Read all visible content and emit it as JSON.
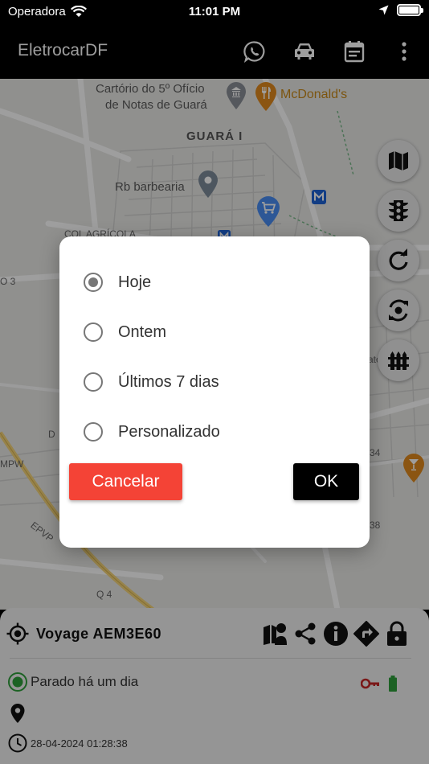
{
  "status_bar": {
    "carrier": "Operadora",
    "time": "11:01 PM"
  },
  "app_bar": {
    "title": "EletrocarDF",
    "actions": [
      "whatsapp-icon",
      "car-icon",
      "event-note-icon",
      "more-vert-icon"
    ]
  },
  "map": {
    "labels": {
      "cartorio_line1": "Cartório do 5º Ofício",
      "cartorio_line2": "de Notas de Guará",
      "mcdonalds": "McDonald's",
      "guara": "GUARÁ I",
      "barbearia": "Rb barbearia",
      "col_agricola": "COL AGRÍCOLA",
      "q3": "O 3",
      "mpw": "MPW",
      "epvp": "EPVP",
      "q4": "Q 4",
      "d": "D",
      "n34": "34",
      "n38": "38",
      "ato": "ato"
    },
    "side_buttons": [
      "map-icon",
      "traffic-light-icon",
      "refresh-icon",
      "sync-icon",
      "fence-icon"
    ]
  },
  "dialog": {
    "options": [
      {
        "label": "Hoje",
        "selected": true
      },
      {
        "label": "Ontem",
        "selected": false
      },
      {
        "label": "Últimos 7 dias",
        "selected": false
      },
      {
        "label": "Personalizado",
        "selected": false
      }
    ],
    "cancel_label": "Cancelar",
    "ok_label": "OK"
  },
  "panel": {
    "vehicle_name": "Voyage AEM3E60",
    "status_text": "Parado há um dia",
    "datetime": "28-04-2024 01:28:38"
  },
  "colors": {
    "cancel": "#f44336",
    "ok": "#000000",
    "status_green": "#2e9e3a",
    "key_red": "#c62828"
  }
}
